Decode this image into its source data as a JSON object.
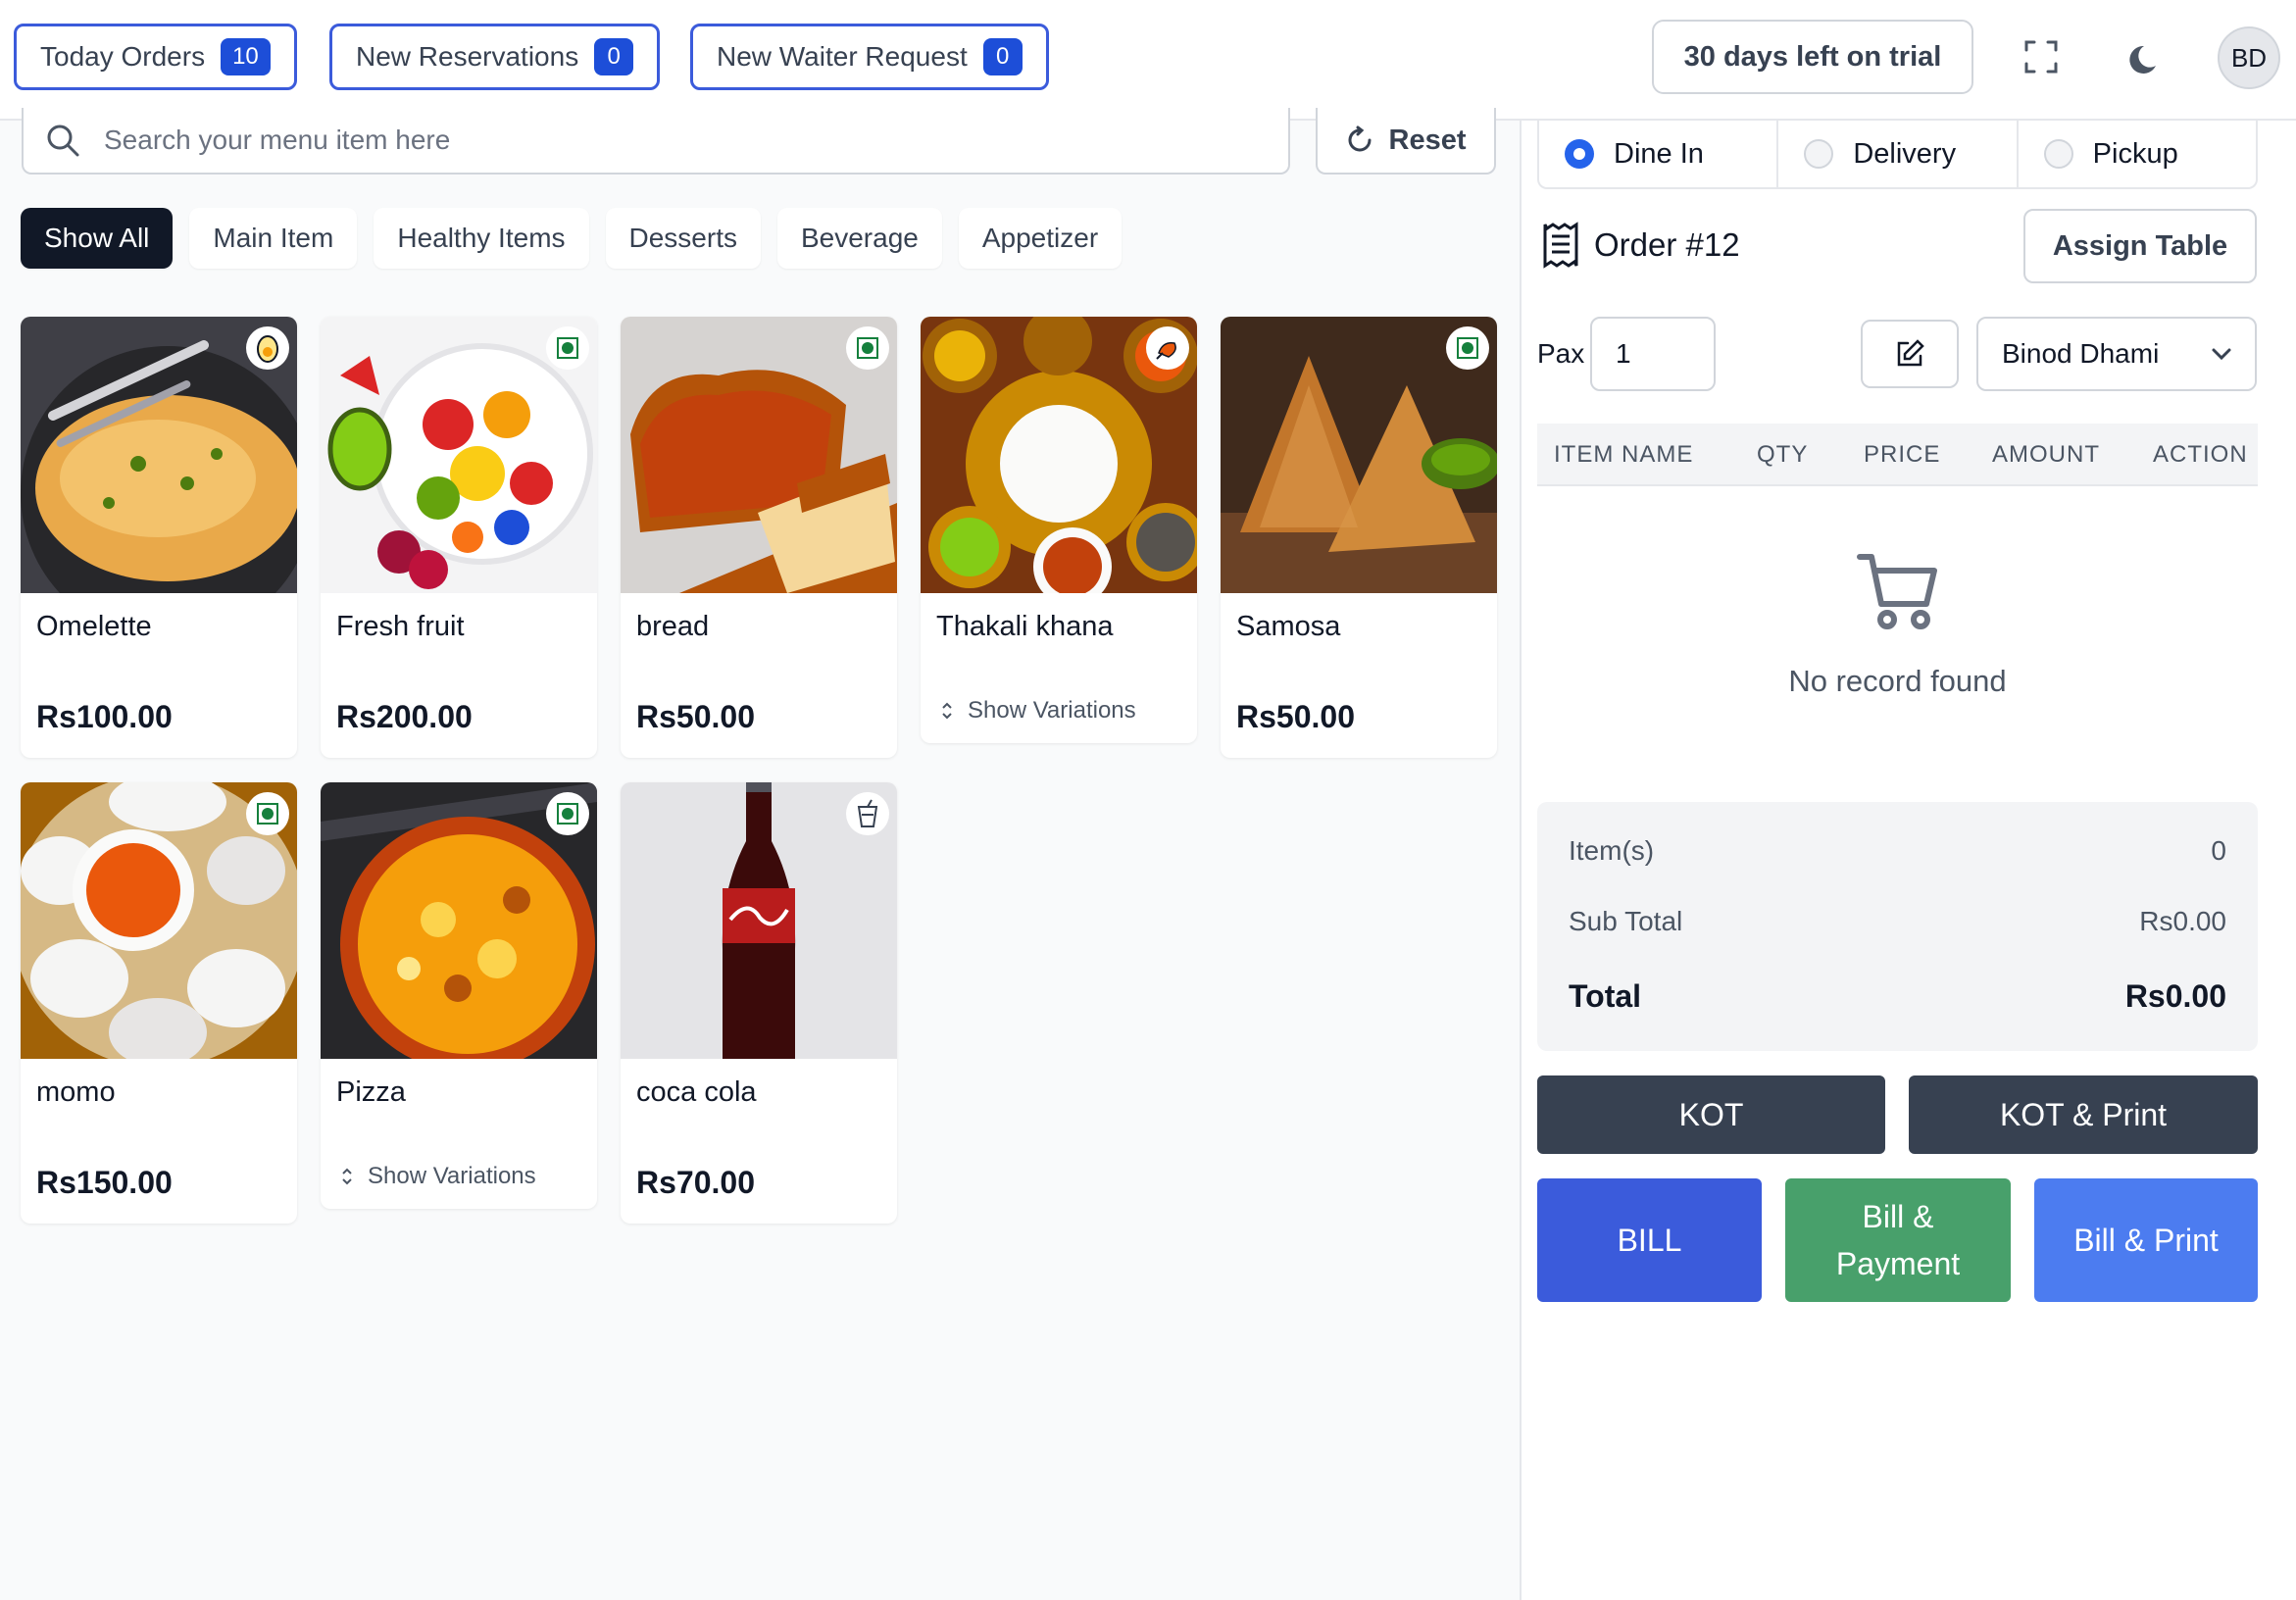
{
  "header": {
    "today_orders": {
      "label": "Today Orders",
      "count": "10"
    },
    "new_reservations": {
      "label": "New Reservations",
      "count": "0"
    },
    "new_waiter_request": {
      "label": "New Waiter Request",
      "count": "0"
    },
    "trial_text": "30 days left on trial",
    "avatar_initials": "BD"
  },
  "search": {
    "placeholder": "Search your menu item here",
    "reset_label": "Reset"
  },
  "categories": [
    "Show All",
    "Main Item",
    "Healthy Items",
    "Desserts",
    "Beverage",
    "Appetizer"
  ],
  "active_category": "Show All",
  "menu_items": [
    {
      "name": "Omelette",
      "price": "Rs100.00",
      "badge": "egg-icon"
    },
    {
      "name": "Fresh fruit",
      "price": "Rs200.00",
      "badge": "veg-icon"
    },
    {
      "name": "bread",
      "price": "Rs50.00",
      "badge": "veg-icon"
    },
    {
      "name": "Thakali khana",
      "variations": "Show Variations",
      "badge": "non-veg-icon"
    },
    {
      "name": "Samosa",
      "price": "Rs50.00",
      "badge": "veg-icon"
    },
    {
      "name": "momo",
      "price": "Rs150.00",
      "badge": "veg-icon"
    },
    {
      "name": "Pizza",
      "variations": "Show Variations",
      "badge": "veg-icon"
    },
    {
      "name": "coca cola",
      "price": "Rs70.00",
      "badge": "drink-icon"
    }
  ],
  "order": {
    "types": [
      "Dine In",
      "Delivery",
      "Pickup"
    ],
    "selected_type": "Dine In",
    "title": "Order #12",
    "assign_table_label": "Assign Table",
    "pax_label": "Pax",
    "pax_value": "1",
    "waiter": "Binod Dhami",
    "table_headers": [
      "ITEM NAME",
      "QTY",
      "PRICE",
      "AMOUNT",
      "ACTION"
    ],
    "empty_message": "No record found",
    "summary": {
      "items_label": "Item(s)",
      "items_value": "0",
      "subtotal_label": "Sub Total",
      "subtotal_value": "Rs0.00",
      "total_label": "Total",
      "total_value": "Rs0.00"
    }
  },
  "actions": {
    "kot": "KOT",
    "kot_print": "KOT & Print",
    "bill": "BILL",
    "bill_payment": "Bill & Payment",
    "bill_print": "Bill & Print"
  },
  "colors": {
    "dark_button": "#374151",
    "bill": "#3b5bdb",
    "bill_payment": "#48a06b",
    "bill_print": "#4c7cf0",
    "accent": "#1d4ed8"
  }
}
